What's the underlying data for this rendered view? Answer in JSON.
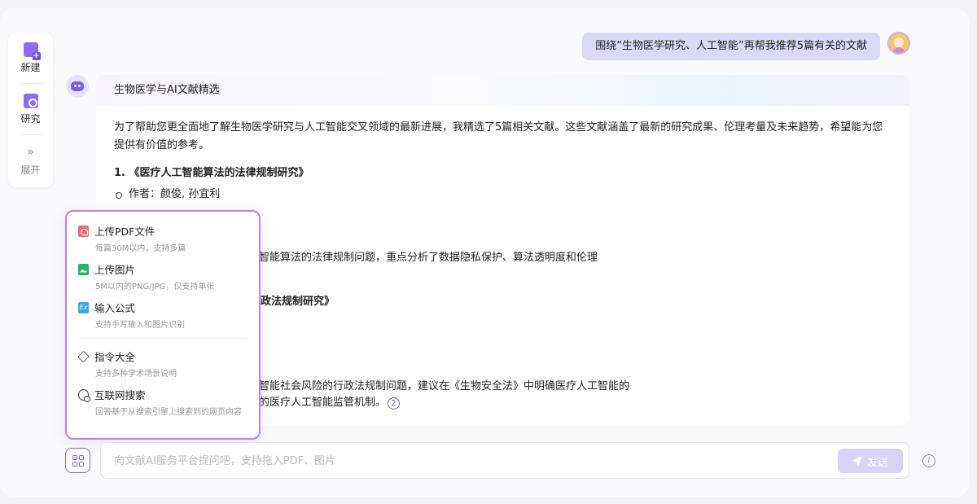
{
  "sidebar": {
    "new_label": "新建",
    "research_label": "研究",
    "expand_label": "展开",
    "expand_glyph": "»"
  },
  "chat": {
    "user_message": "围绕“生物医学研究、人工智能”再帮我推荐5篇有关的文献",
    "answer": {
      "title": "生物医学与AI文献精选",
      "intro": "为了帮助您更全面地了解生物医学研究与人工智能交叉领域的最新进展，我精选了5篇相关文献。这些文献涵盖了最新的研究成果、伦理考量及未来趋势，希望能为您提供有价值的参考。",
      "ref1_title": "1. 《医疗人工智能算法的法律规制研究》",
      "ref1_author": "作者：颜俊, 孙宜利",
      "ref1_abstract_fragment": "智能算法的法律规制问题，重点分析了数据隐私保护、算法透明度和伦理",
      "ref2_title_fragment": "行政法规制研究》",
      "ref2_abstract_fragment1": "智能社会风险的行政法规制问题，建议在《生物安全法》中明确医疗人工智能的",
      "ref2_abstract_fragment2": "的医疗人工智能监管机制。",
      "ref2_cite": "2"
    }
  },
  "popup_menu": {
    "items": [
      {
        "icon": "pdf-icon",
        "title": "上传PDF文件",
        "desc": "每篇30M以内，支持多篇"
      },
      {
        "icon": "image-icon",
        "title": "上传图片",
        "desc": "5M以内的PNG/JPG，仅支持单张"
      },
      {
        "icon": "formula-icon",
        "glyph": "Ex",
        "title": "输入公式",
        "desc": "支持手写输入和图片识别"
      },
      {
        "icon": "cube-icon",
        "title": "指令大全",
        "desc": "支持多种学术场景说明"
      },
      {
        "icon": "web-search-icon",
        "title": "互联网搜索",
        "desc": "回答基于从搜索引擎上搜索到的网页内容"
      }
    ]
  },
  "input": {
    "placeholder": "向文献AI服务平台提问吧，支持拖入PDF、图片",
    "value": "",
    "send_label": "发送",
    "info_glyph": "i"
  },
  "colors": {
    "accent": "#7b66e8",
    "popup_border": "#c27cf0",
    "user_bubble": "#dcd8f7",
    "send_disabled": "#d9d3f8"
  }
}
